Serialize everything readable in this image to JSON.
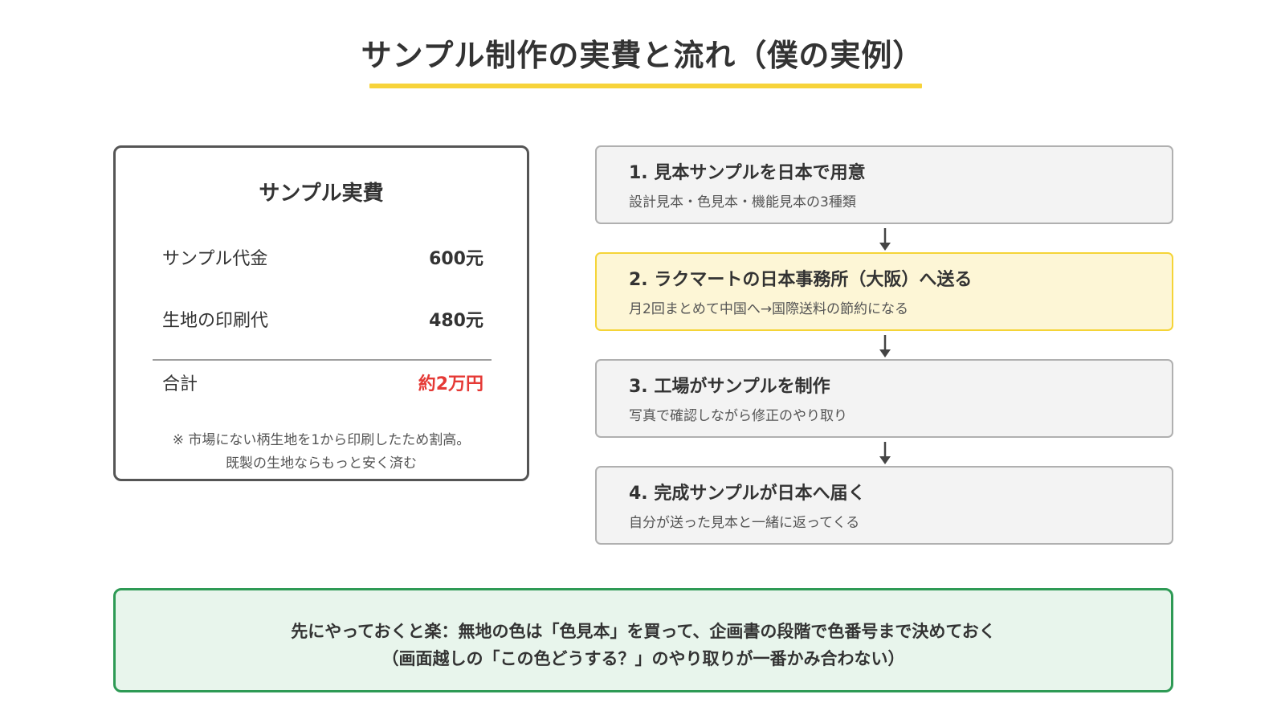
{
  "title": "サンプル制作の実費と流れ（僕の実例）",
  "cost_card": {
    "heading": "サンプル実費",
    "rows": [
      {
        "label": "サンプル代金",
        "value": "600元"
      },
      {
        "label": "生地の印刷代",
        "value": "480元"
      },
      {
        "label": "合計",
        "value": "約2万円"
      }
    ],
    "note_line1": "※ 市場にない柄生地を1から印刷したため割高。",
    "note_line2": "既製の生地ならもっと安く済む"
  },
  "steps": [
    {
      "title": "1.  見本サンプルを日本で用意",
      "desc": "設計見本・色見本・機能見本の3種類"
    },
    {
      "title": "2.  ラクマートの日本事務所（大阪）へ送る",
      "desc": "月2回まとめて中国へ→国際送料の節約になる"
    },
    {
      "title": "3.  工場がサンプルを制作",
      "desc": "写真で確認しながら修正のやり取り"
    },
    {
      "title": "4.  完成サンプルが日本へ届く",
      "desc": "自分が送った見本と一緒に返ってくる"
    }
  ],
  "tip": {
    "line1": "先にやっておくと楽：無地の色は「色見本」を買って、企画書の段階で色番号まで決めておく",
    "line2": "（画面越しの「この色どうする？」のやり取りが一番かみ合わない）"
  },
  "colors": {
    "title_underline": "#f7d33a",
    "total_value": "#e53935",
    "highlight_border": "#f5d437",
    "highlight_fill": "#fdf6d6",
    "tip_border": "#2e9a55",
    "tip_fill": "#e8f5ec"
  }
}
